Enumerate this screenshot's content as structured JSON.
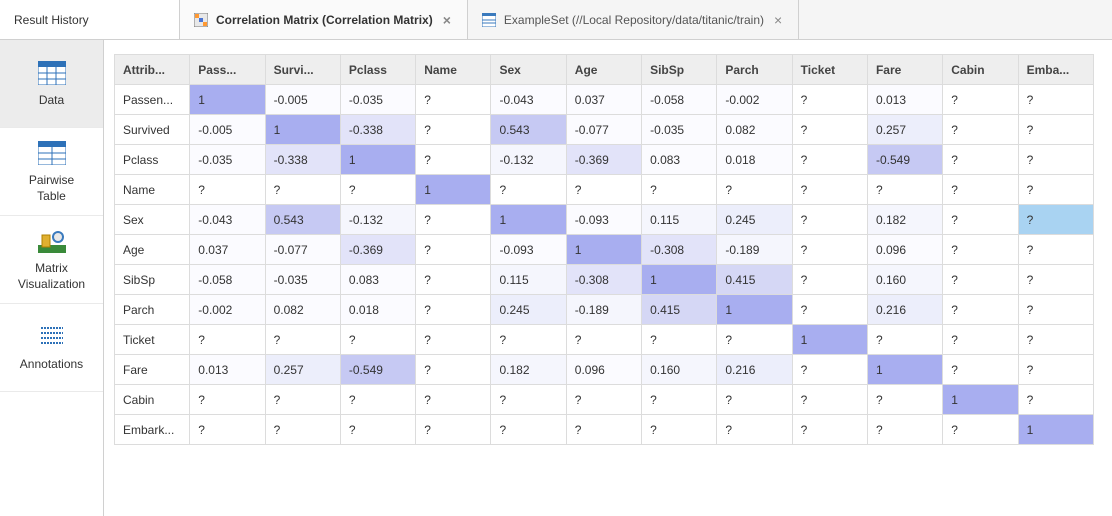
{
  "tabs": {
    "result_history": "Result History",
    "correlation": "Correlation Matrix (Correlation Matrix)",
    "exampleset": "ExampleSet (//Local Repository/data/titanic/train)"
  },
  "sidebar": {
    "data": "Data",
    "pairwise_label1": "Pairwise",
    "pairwise_label2": "Table",
    "matrixviz_label1": "Matrix",
    "matrixviz_label2": "Visualization",
    "annotations": "Annotations"
  },
  "matrix": {
    "header": [
      "Attrib...",
      "Pass...",
      "Survi...",
      "Pclass",
      "Name",
      "Sex",
      "Age",
      "SibSp",
      "Parch",
      "Ticket",
      "Fare",
      "Cabin",
      "Emba..."
    ],
    "rows": [
      {
        "label": "Passen...",
        "cells": [
          {
            "v": "1",
            "h": "h-diag"
          },
          {
            "v": "-0.005",
            "h": "h-0"
          },
          {
            "v": "-0.035",
            "h": "h-0"
          },
          {
            "v": "?",
            "h": ""
          },
          {
            "v": "-0.043",
            "h": "h-0"
          },
          {
            "v": "0.037",
            "h": "h-0"
          },
          {
            "v": "-0.058",
            "h": "h-0"
          },
          {
            "v": "-0.002",
            "h": "h-0"
          },
          {
            "v": "?",
            "h": ""
          },
          {
            "v": "0.013",
            "h": "h-0"
          },
          {
            "v": "?",
            "h": ""
          },
          {
            "v": "?",
            "h": ""
          }
        ]
      },
      {
        "label": "Survived",
        "cells": [
          {
            "v": "-0.005",
            "h": "h-0"
          },
          {
            "v": "1",
            "h": "h-diag"
          },
          {
            "v": "-0.338",
            "h": "h-3"
          },
          {
            "v": "?",
            "h": ""
          },
          {
            "v": "0.543",
            "h": "h-5"
          },
          {
            "v": "-0.077",
            "h": "h-0"
          },
          {
            "v": "-0.035",
            "h": "h-0"
          },
          {
            "v": "0.082",
            "h": "h-0"
          },
          {
            "v": "?",
            "h": ""
          },
          {
            "v": "0.257",
            "h": "h-2"
          },
          {
            "v": "?",
            "h": ""
          },
          {
            "v": "?",
            "h": ""
          }
        ]
      },
      {
        "label": "Pclass",
        "cells": [
          {
            "v": "-0.035",
            "h": "h-0"
          },
          {
            "v": "-0.338",
            "h": "h-3"
          },
          {
            "v": "1",
            "h": "h-diag"
          },
          {
            "v": "?",
            "h": ""
          },
          {
            "v": "-0.132",
            "h": "h-1"
          },
          {
            "v": "-0.369",
            "h": "h-3"
          },
          {
            "v": "0.083",
            "h": "h-0"
          },
          {
            "v": "0.018",
            "h": "h-0"
          },
          {
            "v": "?",
            "h": ""
          },
          {
            "v": "-0.549",
            "h": "h-5"
          },
          {
            "v": "?",
            "h": ""
          },
          {
            "v": "?",
            "h": ""
          }
        ]
      },
      {
        "label": "Name",
        "cells": [
          {
            "v": "?",
            "h": ""
          },
          {
            "v": "?",
            "h": ""
          },
          {
            "v": "?",
            "h": ""
          },
          {
            "v": "1",
            "h": "h-diag"
          },
          {
            "v": "?",
            "h": ""
          },
          {
            "v": "?",
            "h": ""
          },
          {
            "v": "?",
            "h": ""
          },
          {
            "v": "?",
            "h": ""
          },
          {
            "v": "?",
            "h": ""
          },
          {
            "v": "?",
            "h": ""
          },
          {
            "v": "?",
            "h": ""
          },
          {
            "v": "?",
            "h": ""
          }
        ]
      },
      {
        "label": "Sex",
        "cells": [
          {
            "v": "-0.043",
            "h": "h-0"
          },
          {
            "v": "0.543",
            "h": "h-5"
          },
          {
            "v": "-0.132",
            "h": "h-1"
          },
          {
            "v": "?",
            "h": ""
          },
          {
            "v": "1",
            "h": "h-diag"
          },
          {
            "v": "-0.093",
            "h": "h-0"
          },
          {
            "v": "0.115",
            "h": "h-1"
          },
          {
            "v": "0.245",
            "h": "h-2"
          },
          {
            "v": "?",
            "h": ""
          },
          {
            "v": "0.182",
            "h": "h-1"
          },
          {
            "v": "?",
            "h": ""
          },
          {
            "v": "?",
            "h": "h-sel"
          }
        ]
      },
      {
        "label": "Age",
        "cells": [
          {
            "v": "0.037",
            "h": "h-0"
          },
          {
            "v": "-0.077",
            "h": "h-0"
          },
          {
            "v": "-0.369",
            "h": "h-3"
          },
          {
            "v": "?",
            "h": ""
          },
          {
            "v": "-0.093",
            "h": "h-0"
          },
          {
            "v": "1",
            "h": "h-diag"
          },
          {
            "v": "-0.308",
            "h": "h-3"
          },
          {
            "v": "-0.189",
            "h": "h-1"
          },
          {
            "v": "?",
            "h": ""
          },
          {
            "v": "0.096",
            "h": "h-0"
          },
          {
            "v": "?",
            "h": ""
          },
          {
            "v": "?",
            "h": ""
          }
        ]
      },
      {
        "label": "SibSp",
        "cells": [
          {
            "v": "-0.058",
            "h": "h-0"
          },
          {
            "v": "-0.035",
            "h": "h-0"
          },
          {
            "v": "0.083",
            "h": "h-0"
          },
          {
            "v": "?",
            "h": ""
          },
          {
            "v": "0.115",
            "h": "h-1"
          },
          {
            "v": "-0.308",
            "h": "h-3"
          },
          {
            "v": "1",
            "h": "h-diag"
          },
          {
            "v": "0.415",
            "h": "h-4"
          },
          {
            "v": "?",
            "h": ""
          },
          {
            "v": "0.160",
            "h": "h-1"
          },
          {
            "v": "?",
            "h": ""
          },
          {
            "v": "?",
            "h": ""
          }
        ]
      },
      {
        "label": "Parch",
        "cells": [
          {
            "v": "-0.002",
            "h": "h-0"
          },
          {
            "v": "0.082",
            "h": "h-0"
          },
          {
            "v": "0.018",
            "h": "h-0"
          },
          {
            "v": "?",
            "h": ""
          },
          {
            "v": "0.245",
            "h": "h-2"
          },
          {
            "v": "-0.189",
            "h": "h-1"
          },
          {
            "v": "0.415",
            "h": "h-4"
          },
          {
            "v": "1",
            "h": "h-diag"
          },
          {
            "v": "?",
            "h": ""
          },
          {
            "v": "0.216",
            "h": "h-2"
          },
          {
            "v": "?",
            "h": ""
          },
          {
            "v": "?",
            "h": ""
          }
        ]
      },
      {
        "label": "Ticket",
        "cells": [
          {
            "v": "?",
            "h": ""
          },
          {
            "v": "?",
            "h": ""
          },
          {
            "v": "?",
            "h": ""
          },
          {
            "v": "?",
            "h": ""
          },
          {
            "v": "?",
            "h": ""
          },
          {
            "v": "?",
            "h": ""
          },
          {
            "v": "?",
            "h": ""
          },
          {
            "v": "?",
            "h": ""
          },
          {
            "v": "1",
            "h": "h-diag"
          },
          {
            "v": "?",
            "h": ""
          },
          {
            "v": "?",
            "h": ""
          },
          {
            "v": "?",
            "h": ""
          }
        ]
      },
      {
        "label": "Fare",
        "cells": [
          {
            "v": "0.013",
            "h": "h-0"
          },
          {
            "v": "0.257",
            "h": "h-2"
          },
          {
            "v": "-0.549",
            "h": "h-5"
          },
          {
            "v": "?",
            "h": ""
          },
          {
            "v": "0.182",
            "h": "h-1"
          },
          {
            "v": "0.096",
            "h": "h-0"
          },
          {
            "v": "0.160",
            "h": "h-1"
          },
          {
            "v": "0.216",
            "h": "h-2"
          },
          {
            "v": "?",
            "h": ""
          },
          {
            "v": "1",
            "h": "h-diag"
          },
          {
            "v": "?",
            "h": ""
          },
          {
            "v": "?",
            "h": ""
          }
        ]
      },
      {
        "label": "Cabin",
        "cells": [
          {
            "v": "?",
            "h": ""
          },
          {
            "v": "?",
            "h": ""
          },
          {
            "v": "?",
            "h": ""
          },
          {
            "v": "?",
            "h": ""
          },
          {
            "v": "?",
            "h": ""
          },
          {
            "v": "?",
            "h": ""
          },
          {
            "v": "?",
            "h": ""
          },
          {
            "v": "?",
            "h": ""
          },
          {
            "v": "?",
            "h": ""
          },
          {
            "v": "?",
            "h": ""
          },
          {
            "v": "1",
            "h": "h-diag"
          },
          {
            "v": "?",
            "h": ""
          }
        ]
      },
      {
        "label": "Embark...",
        "cells": [
          {
            "v": "?",
            "h": ""
          },
          {
            "v": "?",
            "h": ""
          },
          {
            "v": "?",
            "h": ""
          },
          {
            "v": "?",
            "h": ""
          },
          {
            "v": "?",
            "h": ""
          },
          {
            "v": "?",
            "h": ""
          },
          {
            "v": "?",
            "h": ""
          },
          {
            "v": "?",
            "h": ""
          },
          {
            "v": "?",
            "h": ""
          },
          {
            "v": "?",
            "h": ""
          },
          {
            "v": "?",
            "h": ""
          },
          {
            "v": "1",
            "h": "h-diag"
          }
        ]
      }
    ]
  },
  "chart_data": {
    "type": "heatmap",
    "title": "Correlation Matrix",
    "x_categories": [
      "PassengerId",
      "Survived",
      "Pclass",
      "Name",
      "Sex",
      "Age",
      "SibSp",
      "Parch",
      "Ticket",
      "Fare",
      "Cabin",
      "Embarked"
    ],
    "y_categories": [
      "PassengerId",
      "Survived",
      "Pclass",
      "Name",
      "Sex",
      "Age",
      "SibSp",
      "Parch",
      "Ticket",
      "Fare",
      "Cabin",
      "Embarked"
    ],
    "values": [
      [
        1,
        -0.005,
        -0.035,
        null,
        -0.043,
        0.037,
        -0.058,
        -0.002,
        null,
        0.013,
        null,
        null
      ],
      [
        -0.005,
        1,
        -0.338,
        null,
        0.543,
        -0.077,
        -0.035,
        0.082,
        null,
        0.257,
        null,
        null
      ],
      [
        -0.035,
        -0.338,
        1,
        null,
        -0.132,
        -0.369,
        0.083,
        0.018,
        null,
        -0.549,
        null,
        null
      ],
      [
        null,
        null,
        null,
        1,
        null,
        null,
        null,
        null,
        null,
        null,
        null,
        null
      ],
      [
        -0.043,
        0.543,
        -0.132,
        null,
        1,
        -0.093,
        0.115,
        0.245,
        null,
        0.182,
        null,
        null
      ],
      [
        0.037,
        -0.077,
        -0.369,
        null,
        -0.093,
        1,
        -0.308,
        -0.189,
        null,
        0.096,
        null,
        null
      ],
      [
        -0.058,
        -0.035,
        0.083,
        null,
        0.115,
        -0.308,
        1,
        0.415,
        null,
        0.16,
        null,
        null
      ],
      [
        -0.002,
        0.082,
        0.018,
        null,
        0.245,
        -0.189,
        0.415,
        1,
        null,
        0.216,
        null,
        null
      ],
      [
        null,
        null,
        null,
        null,
        null,
        null,
        null,
        null,
        1,
        null,
        null,
        null
      ],
      [
        0.013,
        0.257,
        -0.549,
        null,
        0.182,
        0.096,
        0.16,
        0.216,
        null,
        1,
        null,
        null
      ],
      [
        null,
        null,
        null,
        null,
        null,
        null,
        null,
        null,
        null,
        null,
        1,
        null
      ],
      [
        null,
        null,
        null,
        null,
        null,
        null,
        null,
        null,
        null,
        null,
        null,
        1
      ]
    ],
    "xlabel": "Attributes",
    "ylabel": "Attributes"
  }
}
